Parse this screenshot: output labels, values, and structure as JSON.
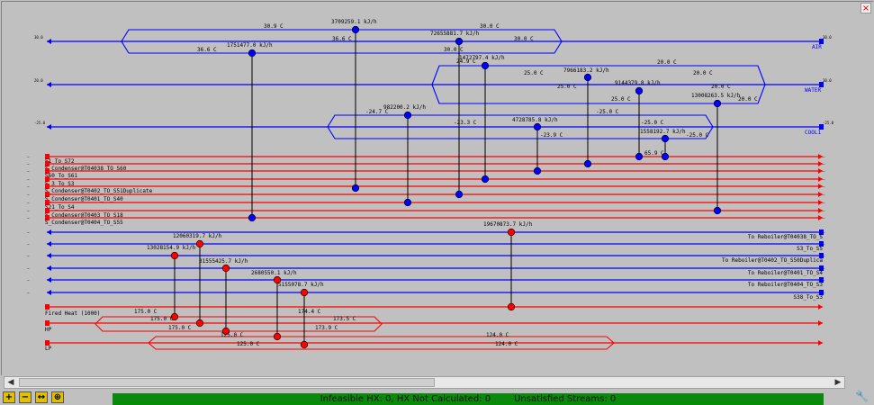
{
  "colors": {
    "cold": "#0000ff",
    "hot": "#ff0000",
    "status_bg": "#0a8a0a",
    "background": "#c0c0c0"
  },
  "status": {
    "infeasible": "Infeasible HX: 0, HX Not Calculated: 0",
    "unsatisfied": "Unsatisfied Streams: 0"
  },
  "toolbar": [
    {
      "name": "zoom-in-button",
      "symbol": "+"
    },
    {
      "name": "zoom-out-button",
      "symbol": "−"
    },
    {
      "name": "fit-width-button",
      "symbol": "↔"
    },
    {
      "name": "fit-all-button",
      "symbol": "⊕"
    }
  ],
  "utility_streams": [
    {
      "name": "AIR",
      "in_temp": "30.0",
      "out_temp": "30.0"
    },
    {
      "name": "WATER",
      "in_temp": "20.0",
      "out_temp": "30.0"
    },
    {
      "name": "COOL1",
      "in_temp": "-25.0",
      "out_temp": "-25.0"
    }
  ],
  "hot_process_streams": [
    "51_To_S72",
    "S_Condenser@T04038_TO_S60",
    "S60_To_S61",
    "S_3_To_S3",
    "S_Condenser@T0402_TO_S51Duplicate",
    "S_Condenser@T0401_TO_S40",
    "S21_To_S4",
    "S_Condenser@T0403_TO_S18",
    "S_Condenser@T0404_TO_S55"
  ],
  "cold_process_streams": [
    "To Reboiler@T04038_TO_S",
    "S3_To_S5",
    "To Reboiler@T0402_TO_S50Duplica",
    "To Reboiler@T0401_TO_S4",
    "To Reboiler@T0404_TO_S3",
    "S38_To_S3"
  ],
  "hot_utilities": [
    {
      "name": "Fired Heat (1000)"
    },
    {
      "name": "HP"
    },
    {
      "name": "LP"
    }
  ],
  "exchanger_duties": [
    "3709259.1 kJ/h",
    "72655881.7 kJ/h",
    "1751477.0 kJ/h",
    "1472797.4 kJ/h",
    "7966183.2 kJ/h",
    "9144379.8 kJ/h",
    "13008263.5 kJ/h",
    "982200.2 kJ/h",
    "4728785.8 kJ/h",
    "1558192.7 kJ/h",
    "19670873.7 kJ/h",
    "12060319.7 kJ/h",
    "13028154.9 kJ/h",
    "31555425.7 kJ/h",
    "2680550.1 kJ/h",
    "5155078.7 kJ/h"
  ],
  "temperatures": [
    "30.9 C",
    "36.6 C",
    "36.6 C",
    "30.0 C",
    "30.0 C",
    "30.0 C",
    "25.0 C",
    "25.0 C",
    "20.0 C",
    "20.0 C",
    "25.0 C",
    "20.0 C",
    "20.0 C",
    "24.9 C",
    "-24.7 C",
    "-23.3 C",
    "-23.9 C",
    "-25.0 C",
    "-25.0 C",
    "-25.0 C",
    "65.9 C",
    "175.0 C",
    "175.0 C",
    "175.0 C",
    "174.4 C",
    "173.5 C",
    "173.9 C",
    "125.0 C",
    "125.0 C",
    "124.0 C",
    "124.0 C"
  ]
}
